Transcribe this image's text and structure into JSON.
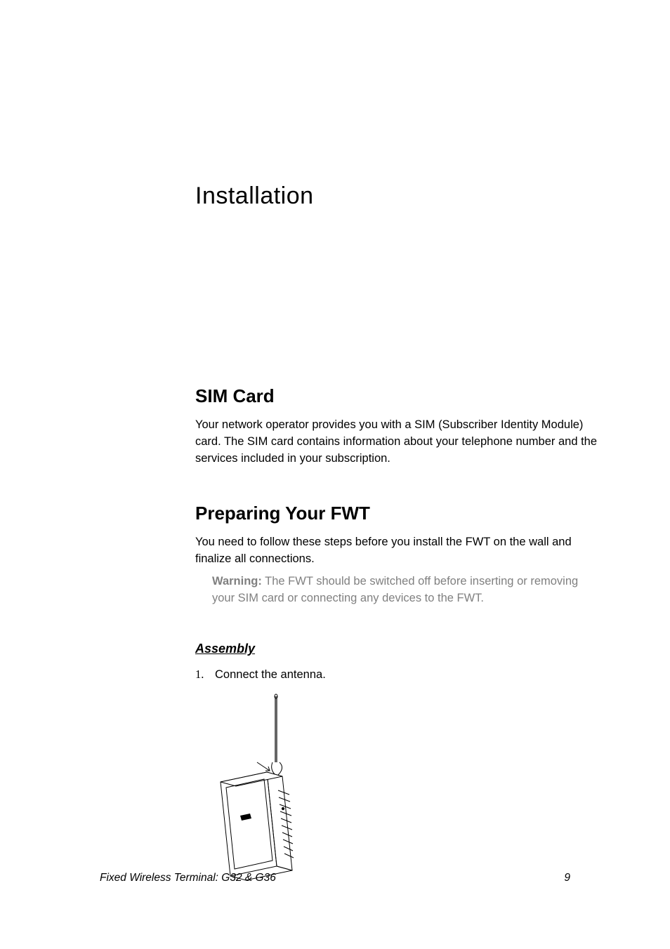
{
  "chapter_title": "Installation",
  "sim_card": {
    "title": "SIM Card",
    "body": "Your network operator provides you with a SIM (Subscriber Identity Module) card. The SIM card contains information about your telephone number and the services included in your subscription."
  },
  "preparing": {
    "title": "Preparing Your FWT",
    "body": "You need to follow these steps before you install the FWT on the wall and finalize all connections.",
    "warning_label": "Warning:",
    "warning_text": " The FWT should be switched off before inserting or removing your SIM card or connecting any devices to the FWT."
  },
  "assembly": {
    "title": "Assembly",
    "step_num": "1.",
    "step_text": "Connect the antenna."
  },
  "footer": {
    "left": "Fixed Wireless Terminal: G32 & G36",
    "right": "9"
  }
}
